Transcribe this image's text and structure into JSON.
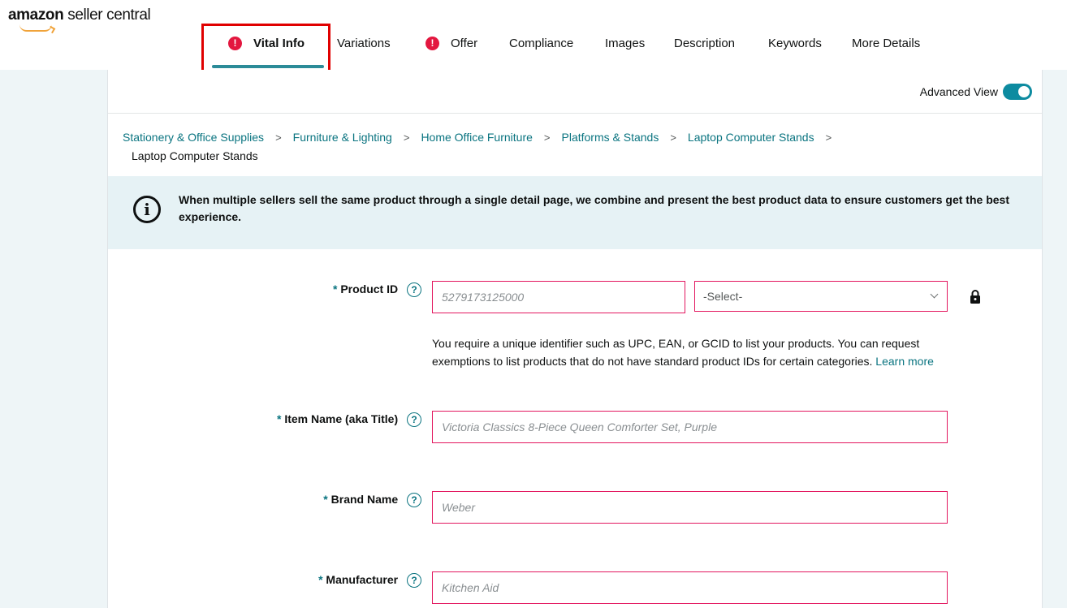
{
  "logo": {
    "brand": "amazon",
    "product": " seller central"
  },
  "tabs": [
    {
      "label": "Vital Info",
      "has_error": true,
      "active": true
    },
    {
      "label": "Variations",
      "has_error": false
    },
    {
      "label": "Offer",
      "has_error": true
    },
    {
      "label": "Compliance",
      "has_error": false
    },
    {
      "label": "Images",
      "has_error": false
    },
    {
      "label": "Description",
      "has_error": false
    },
    {
      "label": "Keywords",
      "has_error": false
    },
    {
      "label": "More Details",
      "has_error": false
    }
  ],
  "advanced_view": {
    "label": "Advanced View",
    "enabled": true
  },
  "breadcrumb": {
    "items": [
      "Stationery & Office Supplies",
      "Furniture & Lighting",
      "Home Office Furniture",
      "Platforms & Stands",
      "Laptop Computer Stands"
    ],
    "separator": ">",
    "last": "Laptop Computer Stands"
  },
  "info_banner": {
    "icon": "info-circle-icon",
    "text": "When multiple sellers sell the same product through a single detail page, we combine and present the best product data to ensure customers get the best experience."
  },
  "form": {
    "required_mark": "*",
    "help_glyph": "?",
    "product_id": {
      "label": "Product ID",
      "placeholder": "5279173125000",
      "type_select": "-Select-",
      "help_text": "You require a unique identifier such as UPC, EAN, or GCID to list your products. You can request exemptions to list products that do not have standard product IDs for certain categories.",
      "learn_more": "Learn more"
    },
    "item_name": {
      "label": "Item Name (aka Title)",
      "placeholder": "Victoria Classics 8-Piece Queen Comforter Set, Purple"
    },
    "brand_name": {
      "label": "Brand Name",
      "placeholder": "Weber"
    },
    "manufacturer": {
      "label": "Manufacturer",
      "placeholder": "Kitchen Aid"
    }
  },
  "colors": {
    "accent": "#0a7480",
    "error": "#e3173f",
    "toggle": "#0d8ba0",
    "highlight": "#e00000"
  }
}
